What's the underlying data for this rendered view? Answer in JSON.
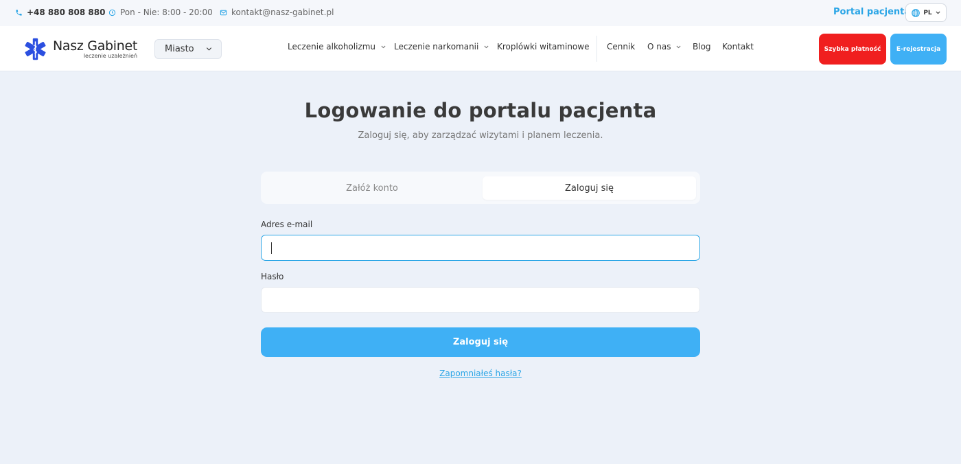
{
  "topbar": {
    "phone": "+48 880 808 880",
    "hours": "Pon - Nie: 8:00 - 20:00",
    "email": "kontakt@nasz-gabinet.pl",
    "portal_link": "Portal pacjenta",
    "language": "PL"
  },
  "header": {
    "logo_title": "Nasz Gabinet",
    "logo_subtitle": "leczenie uzależnień",
    "city_select": "Miasto",
    "nav": {
      "alcohol": "Leczenie alkoholizmu",
      "drugs": "Leczenie narkomanii",
      "vitamins": "Kroplówki witaminowe",
      "pricing": "Cennik",
      "about": "O nas",
      "blog": "Blog",
      "contact": "Kontakt"
    },
    "quick_payment": "Szybka płatność",
    "e_registration": "E-rejestracja"
  },
  "main": {
    "title": "Logowanie do portalu pacjenta",
    "subtitle": "Zaloguj się, aby zarządzać wizytami i planem leczenia.",
    "tabs": {
      "register": "Załóż konto",
      "login": "Zaloguj się",
      "active": "login"
    },
    "email_label": "Adres e-mail",
    "email_value": "",
    "password_label": "Hasło",
    "password_value": "",
    "submit_label": "Zaloguj się",
    "forgot_link": "Zapomniałeś hasła?"
  },
  "colors": {
    "accent": "#3fb0f5",
    "link": "#2aa5e6",
    "danger": "#f01f1f",
    "logo_blue": "#2b4fe0",
    "background": "#ecf1f9"
  }
}
